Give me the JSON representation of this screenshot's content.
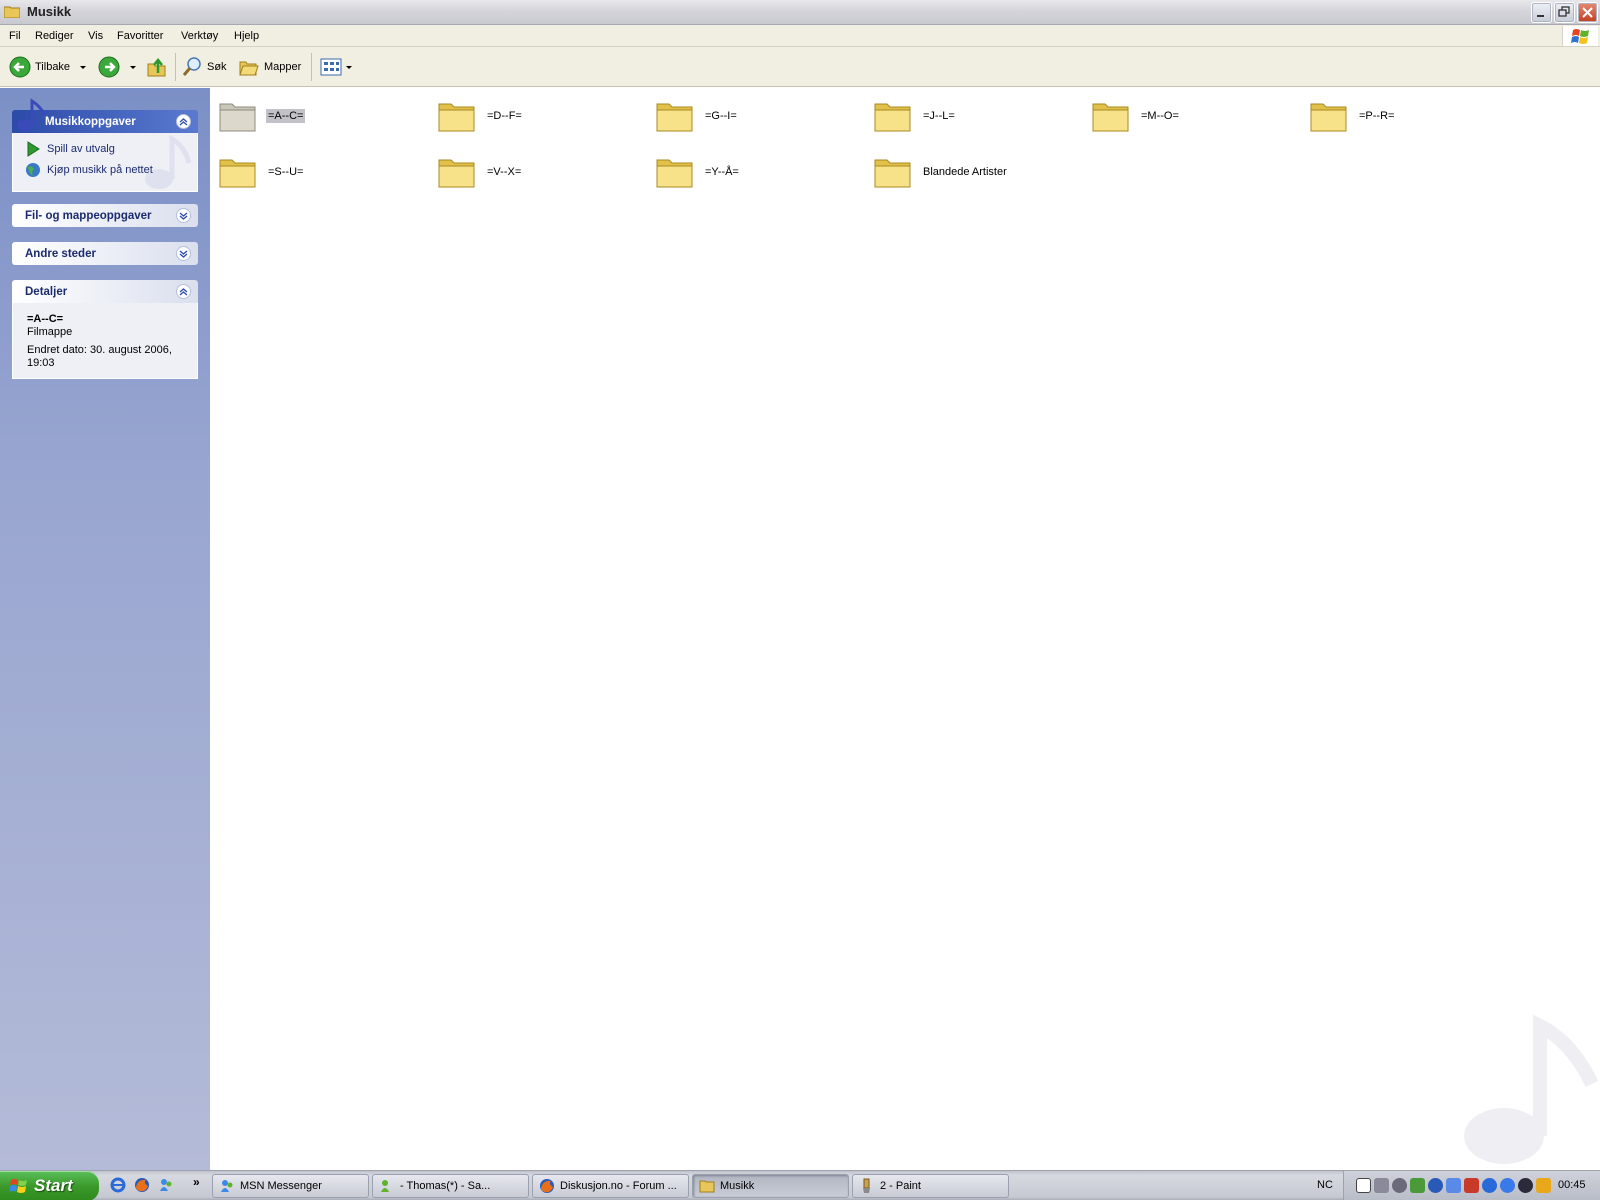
{
  "window": {
    "title": "Musikk"
  },
  "menu": [
    "Fil",
    "Rediger",
    "Vis",
    "Favoritter",
    "Verktøy",
    "Hjelp"
  ],
  "toolbar": {
    "back_label": "Tilbake",
    "search_label": "Søk",
    "folders_label": "Mapper"
  },
  "sidebar": {
    "music_tasks": {
      "title": "Musikkoppgaver",
      "items": [
        {
          "label": "Spill av utvalg",
          "icon": "play-icon"
        },
        {
          "label": "Kjøp musikk på nettet",
          "icon": "globe-icon"
        }
      ]
    },
    "file_tasks": {
      "title": "Fil- og mappeoppgaver"
    },
    "other_places": {
      "title": "Andre steder"
    },
    "details": {
      "title": "Detaljer",
      "name": "=A--C=",
      "type": "Filmappe",
      "modified": "Endret dato: 30. august 2006, 19:03"
    }
  },
  "folders": [
    {
      "name": "=A--C=",
      "selected": true
    },
    {
      "name": "=D--F="
    },
    {
      "name": "=G--I="
    },
    {
      "name": "=J--L="
    },
    {
      "name": "=M--O="
    },
    {
      "name": "=P--R="
    },
    {
      "name": "=S--U="
    },
    {
      "name": "=V--X="
    },
    {
      "name": "=Y--Å="
    },
    {
      "name": "Blandede Artister"
    }
  ],
  "taskbar": {
    "start_label": "Start",
    "tasks": [
      {
        "label": "MSN Messenger",
        "icon": "msn-icon"
      },
      {
        "label": "-      Thomas(*) - Sa...",
        "icon": "chat-icon"
      },
      {
        "label": "Diskusjon.no - Forum ...",
        "icon": "firefox-icon"
      },
      {
        "label": "Musikk",
        "icon": "folder-icon",
        "active": true
      },
      {
        "label": "2 - Paint",
        "icon": "paint-icon"
      }
    ],
    "tray_label": "NC",
    "clock": "00:45"
  }
}
